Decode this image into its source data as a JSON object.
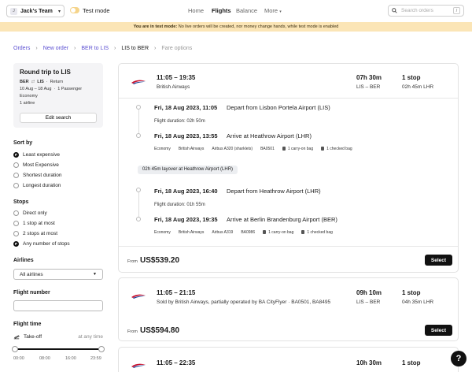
{
  "nav": {
    "team_initial": "J",
    "team_name": "Jack's Team",
    "test_mode_label": "Test mode",
    "links": [
      "Home",
      "Flights",
      "Balance",
      "More"
    ],
    "active_link": "Flights",
    "search_placeholder": "Search orders",
    "search_shortcut": "/"
  },
  "banner": {
    "bold": "You are in test mode:",
    "text": " No live orders will be created, nor money change hands, while test mode is enabled"
  },
  "breadcrumb": [
    "Orders",
    "New order",
    "BER to LIS",
    "LIS to BER",
    "Fare options"
  ],
  "trip": {
    "title": "Round trip to LIS",
    "from": "BER",
    "to": "LIS",
    "type": "Return",
    "dates": "10 Aug – 18 Aug",
    "passengers": "1 Passenger",
    "cabin": "Economy",
    "airlines": "1 airline",
    "edit_label": "Edit search"
  },
  "sort": {
    "title": "Sort by",
    "options": [
      "Least expensive",
      "Most Expensive",
      "Shortest duration",
      "Longest duration"
    ],
    "selected_index": 0
  },
  "stops": {
    "title": "Stops",
    "options": [
      "Direct only",
      "1 stop at most",
      "2 stops at most",
      "Any number of stops"
    ],
    "selected_index": 3
  },
  "airlines_filter": {
    "title": "Airlines",
    "value": "All airlines"
  },
  "flight_number": {
    "title": "Flight number",
    "value": ""
  },
  "flight_time": {
    "title": "Flight time",
    "takeoff_label": "Take-off",
    "takeoff_value": "at any time",
    "ticks": [
      "00:00",
      "08:00",
      "16:00",
      "23:59"
    ]
  },
  "results": [
    {
      "times": "11:05 – 19:35",
      "airline": "British Airways",
      "duration": "07h 30m",
      "route": "LIS – BER",
      "stops": "1 stop",
      "stop_detail": "02h 45m LHR",
      "segments": [
        {
          "dep_date": "Fri, 18 Aug 2023, 11:05",
          "dep_text": "Depart from Lisbon Portela Airport (LIS)",
          "flight_duration": "Flight duration: 02h 50m",
          "arr_date": "Fri, 18 Aug 2023, 13:55",
          "arr_text": "Arrive at Heathrow Airport (LHR)",
          "tags": [
            "Economy",
            "British Airways",
            "Airbus A320 (sharklets)",
            "BA0501",
            "1 carry-on bag",
            "1 checked bag"
          ]
        },
        {
          "dep_date": "Fri, 18 Aug 2023, 16:40",
          "dep_text": "Depart from Heathrow Airport (LHR)",
          "flight_duration": "Flight duration: 01h 55m",
          "arr_date": "Fri, 18 Aug 2023, 19:35",
          "arr_text": "Arrive at Berlin Brandenburg Airport (BER)",
          "tags": [
            "Economy",
            "British Airways",
            "Airbus A319",
            "BA0986",
            "1 carry-on bag",
            "1 checked bag"
          ]
        }
      ],
      "layover": "02h 45m layover at Heathrow Airport (LHR)",
      "from_label": "From",
      "price": "US$539.20",
      "select_label": "Select"
    },
    {
      "times": "11:05 – 21:15",
      "airline": "Sold by British Airways, partially operated by BA CityFlyer · BA0501, BA8495",
      "duration": "09h 10m",
      "route": "LIS – BER",
      "stops": "1 stop",
      "stop_detail": "04h 35m LHR",
      "from_label": "From",
      "price": "US$594.80",
      "select_label": "Select"
    },
    {
      "times": "11:05 – 22:35",
      "duration": "10h 30m",
      "stops": "1 stop"
    }
  ],
  "help_label": "?",
  "colors": {
    "accent": "#5b4fd1",
    "banner": "#fbe5b6",
    "primary_button": "#111111",
    "toggle": "#f5d48a"
  }
}
